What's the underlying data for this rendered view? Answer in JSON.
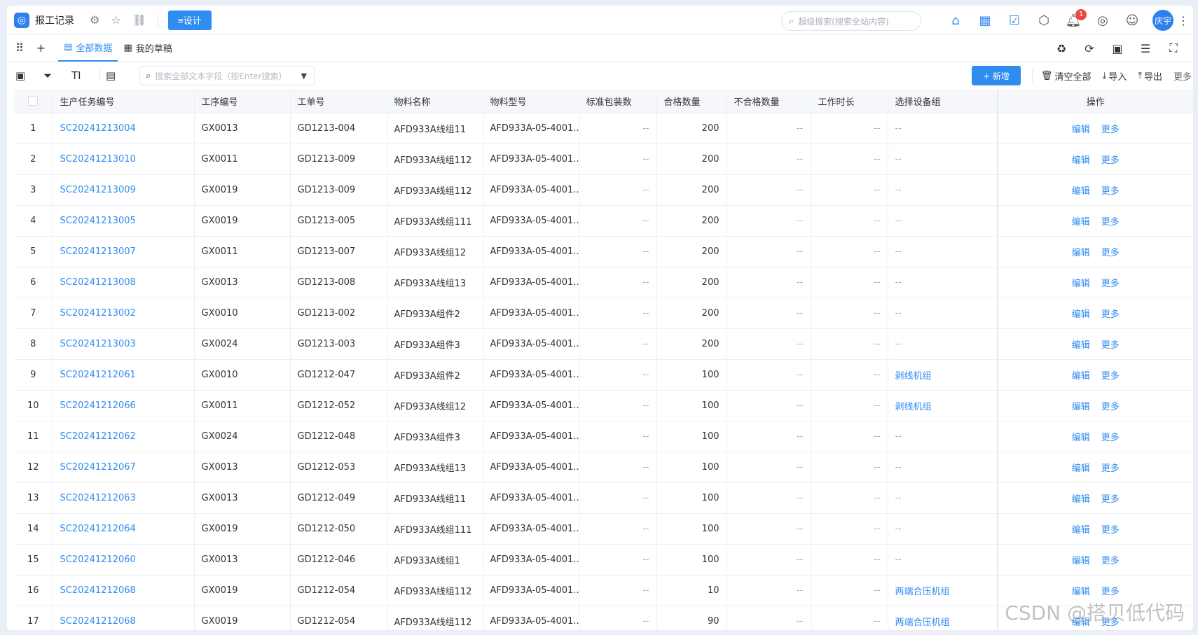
{
  "topbar": {
    "app_title": "报工记录",
    "design_label": "≡设计",
    "search_placeholder": "超级搜索(搜索全站内容)",
    "notification_count": "1",
    "avatar_text": "庆宇"
  },
  "tabs": {
    "all_data": "全部数据",
    "my_drafts": "我的草稿"
  },
  "toolbar": {
    "search_placeholder": "搜索全部文本字段（按Enter搜索）",
    "add_label": "+ 新增",
    "clear_all": "清空全部",
    "import": "导入",
    "export": "导出",
    "more": "更多"
  },
  "table": {
    "headers": [
      "生产任务编号",
      "工序编号",
      "工单号",
      "物料名称",
      "物料型号",
      "标准包装数",
      "合格数量",
      "不合格数量",
      "工作时长",
      "选择设备组",
      "操作"
    ],
    "edit_label": "编辑",
    "more_label": "更多",
    "rows": [
      {
        "idx": "1",
        "task": "SC20241213004",
        "proc": "GX0013",
        "order": "GD1213-004",
        "mat": "AFD933A线组11",
        "model": "AFD933A-05-4001...",
        "pack": "--",
        "ok": "200",
        "ng": "--",
        "hours": "--",
        "dev": "--"
      },
      {
        "idx": "2",
        "task": "SC20241213010",
        "proc": "GX0011",
        "order": "GD1213-009",
        "mat": "AFD933A线组112",
        "model": "AFD933A-05-4001...",
        "pack": "--",
        "ok": "200",
        "ng": "--",
        "hours": "--",
        "dev": "--"
      },
      {
        "idx": "3",
        "task": "SC20241213009",
        "proc": "GX0019",
        "order": "GD1213-009",
        "mat": "AFD933A线组112",
        "model": "AFD933A-05-4001...",
        "pack": "--",
        "ok": "200",
        "ng": "--",
        "hours": "--",
        "dev": "--"
      },
      {
        "idx": "4",
        "task": "SC20241213005",
        "proc": "GX0019",
        "order": "GD1213-005",
        "mat": "AFD933A线组111",
        "model": "AFD933A-05-4001...",
        "pack": "--",
        "ok": "200",
        "ng": "--",
        "hours": "--",
        "dev": "--"
      },
      {
        "idx": "5",
        "task": "SC20241213007",
        "proc": "GX0011",
        "order": "GD1213-007",
        "mat": "AFD933A线组12",
        "model": "AFD933A-05-4001...",
        "pack": "--",
        "ok": "200",
        "ng": "--",
        "hours": "--",
        "dev": "--"
      },
      {
        "idx": "6",
        "task": "SC20241213008",
        "proc": "GX0013",
        "order": "GD1213-008",
        "mat": "AFD933A线组13",
        "model": "AFD933A-05-4001...",
        "pack": "--",
        "ok": "200",
        "ng": "--",
        "hours": "--",
        "dev": "--"
      },
      {
        "idx": "7",
        "task": "SC20241213002",
        "proc": "GX0010",
        "order": "GD1213-002",
        "mat": "AFD933A组件2",
        "model": "AFD933A-05-4001...",
        "pack": "--",
        "ok": "200",
        "ng": "--",
        "hours": "--",
        "dev": "--"
      },
      {
        "idx": "8",
        "task": "SC20241213003",
        "proc": "GX0024",
        "order": "GD1213-003",
        "mat": "AFD933A组件3",
        "model": "AFD933A-05-4001...",
        "pack": "--",
        "ok": "200",
        "ng": "--",
        "hours": "--",
        "dev": "--"
      },
      {
        "idx": "9",
        "task": "SC20241212061",
        "proc": "GX0010",
        "order": "GD1212-047",
        "mat": "AFD933A组件2",
        "model": "AFD933A-05-4001...",
        "pack": "--",
        "ok": "100",
        "ng": "--",
        "hours": "--",
        "dev": "剥线机组"
      },
      {
        "idx": "10",
        "task": "SC20241212066",
        "proc": "GX0011",
        "order": "GD1212-052",
        "mat": "AFD933A线组12",
        "model": "AFD933A-05-4001...",
        "pack": "--",
        "ok": "100",
        "ng": "--",
        "hours": "--",
        "dev": "剥线机组"
      },
      {
        "idx": "11",
        "task": "SC20241212062",
        "proc": "GX0024",
        "order": "GD1212-048",
        "mat": "AFD933A组件3",
        "model": "AFD933A-05-4001...",
        "pack": "--",
        "ok": "100",
        "ng": "--",
        "hours": "--",
        "dev": "--"
      },
      {
        "idx": "12",
        "task": "SC20241212067",
        "proc": "GX0013",
        "order": "GD1212-053",
        "mat": "AFD933A线组13",
        "model": "AFD933A-05-4001...",
        "pack": "--",
        "ok": "100",
        "ng": "--",
        "hours": "--",
        "dev": "--"
      },
      {
        "idx": "13",
        "task": "SC20241212063",
        "proc": "GX0013",
        "order": "GD1212-049",
        "mat": "AFD933A线组11",
        "model": "AFD933A-05-4001...",
        "pack": "--",
        "ok": "100",
        "ng": "--",
        "hours": "--",
        "dev": "--"
      },
      {
        "idx": "14",
        "task": "SC20241212064",
        "proc": "GX0019",
        "order": "GD1212-050",
        "mat": "AFD933A线组111",
        "model": "AFD933A-05-4001...",
        "pack": "--",
        "ok": "100",
        "ng": "--",
        "hours": "--",
        "dev": "--"
      },
      {
        "idx": "15",
        "task": "SC20241212060",
        "proc": "GX0013",
        "order": "GD1212-046",
        "mat": "AFD933A线组1",
        "model": "AFD933A-05-4001...",
        "pack": "--",
        "ok": "100",
        "ng": "--",
        "hours": "--",
        "dev": "--"
      },
      {
        "idx": "16",
        "task": "SC20241212068",
        "proc": "GX0019",
        "order": "GD1212-054",
        "mat": "AFD933A线组112",
        "model": "AFD933A-05-4001...",
        "pack": "--",
        "ok": "10",
        "ng": "--",
        "hours": "--",
        "dev": "两端合压机组"
      },
      {
        "idx": "17",
        "task": "SC20241212068",
        "proc": "GX0019",
        "order": "GD1212-054",
        "mat": "AFD933A线组112",
        "model": "AFD933A-05-4001...",
        "pack": "--",
        "ok": "90",
        "ng": "--",
        "hours": "--",
        "dev": "两端合压机组"
      }
    ]
  },
  "watermark": "CSDN @搭贝低代码"
}
